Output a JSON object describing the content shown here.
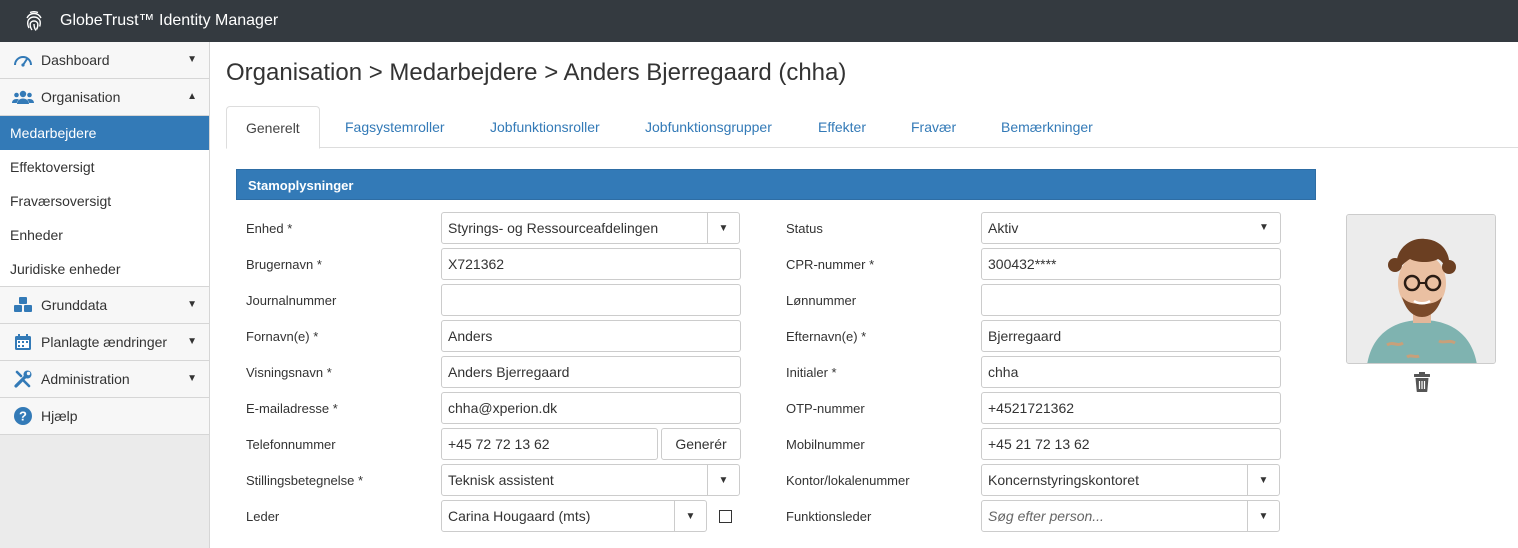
{
  "app": {
    "title": "GlobeTrust™ Identity Manager"
  },
  "sidebar": {
    "groups": [
      {
        "label": "Dashboard",
        "icon": "dashboard-gauge-icon",
        "caret": "▼"
      },
      {
        "label": "Organisation",
        "icon": "users-icon",
        "caret": "▲"
      },
      {
        "label": "Grunddata",
        "icon": "cubes-icon",
        "caret": "▼"
      },
      {
        "label": "Planlagte ændringer",
        "icon": "calendar-icon",
        "caret": "▼"
      },
      {
        "label": "Administration",
        "icon": "tools-icon",
        "caret": "▼"
      },
      {
        "label": "Hjælp",
        "icon": "question-circle-icon",
        "caret": ""
      }
    ],
    "org_items": [
      {
        "label": "Medarbejdere",
        "active": true
      },
      {
        "label": "Effektoversigt"
      },
      {
        "label": "Fraværsoversigt"
      },
      {
        "label": "Enheder"
      },
      {
        "label": "Juridiske enheder"
      }
    ]
  },
  "page": {
    "title": "Organisation > Medarbejdere > Anders Bjerregaard (chha)"
  },
  "tabs": [
    "Generelt",
    "Fagsystemroller",
    "Jobfunktionsroller",
    "Jobfunktionsgrupper",
    "Effekter",
    "Fravær",
    "Bemærkninger"
  ],
  "panel": {
    "title": "Stamoplysninger"
  },
  "form": {
    "left": [
      {
        "label": "Enhed *",
        "value": "Styrings- og Ressourceafdelingen",
        "type": "select"
      },
      {
        "label": "Brugernavn *",
        "value": "X721362",
        "type": "text"
      },
      {
        "label": "Journalnummer",
        "value": "",
        "type": "text"
      },
      {
        "label": "Fornavn(e) *",
        "value": "Anders",
        "type": "text"
      },
      {
        "label": "Visningsnavn *",
        "value": "Anders Bjerregaard",
        "type": "text"
      },
      {
        "label": "E-mailadresse *",
        "value": "chha@xperion.dk",
        "type": "text"
      },
      {
        "label": "Telefonnummer",
        "value": "+45 72 72 13 62",
        "type": "text-button",
        "button": "Generér"
      },
      {
        "label": "Stillingsbetegnelse *",
        "value": "Teknisk assistent",
        "type": "select"
      },
      {
        "label": "Leder",
        "value": "Carina Hougaard (mts)",
        "type": "select-check"
      }
    ],
    "right": [
      {
        "label": "Status",
        "value": "Aktiv",
        "type": "native-select"
      },
      {
        "label": "CPR-nummer *",
        "value": "300432****",
        "type": "text"
      },
      {
        "label": "Lønnummer",
        "value": "",
        "type": "text"
      },
      {
        "label": "Efternavn(e) *",
        "value": "Bjerregaard",
        "type": "text"
      },
      {
        "label": "Initialer *",
        "value": "chha",
        "type": "text"
      },
      {
        "label": "OTP-nummer",
        "value": "+4521721362",
        "type": "text"
      },
      {
        "label": "Mobilnummer",
        "value": "+45 21 72 13 62",
        "type": "text"
      },
      {
        "label": "Kontor/lokalenummer",
        "value": "Koncernstyringskontoret",
        "type": "select"
      },
      {
        "label": "Funktionsleder",
        "placeholder": "Søg efter person...",
        "type": "select"
      }
    ]
  },
  "caret_down": "▼",
  "colors": {
    "topbar": "#343a40",
    "primary": "#337ab7"
  }
}
